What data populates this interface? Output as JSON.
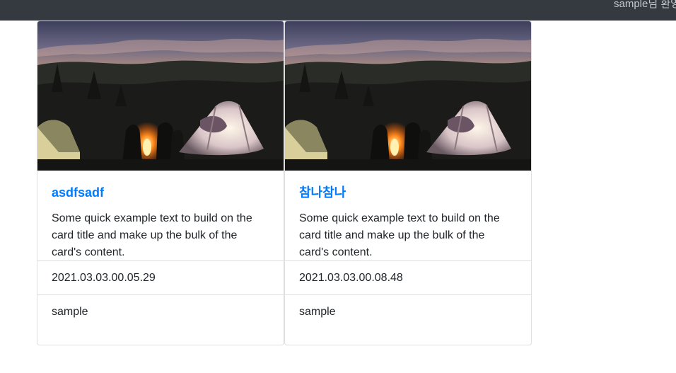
{
  "navbar": {
    "text": "sample님 환영"
  },
  "cards": [
    {
      "title": "asdfsadf",
      "text": "Some quick example text to build on the card title and make up the bulk of the card's content.",
      "date": "2021.03.03.00.05.29",
      "author": "sample",
      "image": "camping-tent-night-photo"
    },
    {
      "title": "참나참나",
      "text": "Some quick example text to build on the card title and make up the bulk of the card's content.",
      "date": "2021.03.03.00.08.48",
      "author": "sample",
      "image": "camping-tent-night-photo"
    }
  ],
  "colors": {
    "navbar_bg": "#343a40",
    "title_link": "#007bff"
  }
}
